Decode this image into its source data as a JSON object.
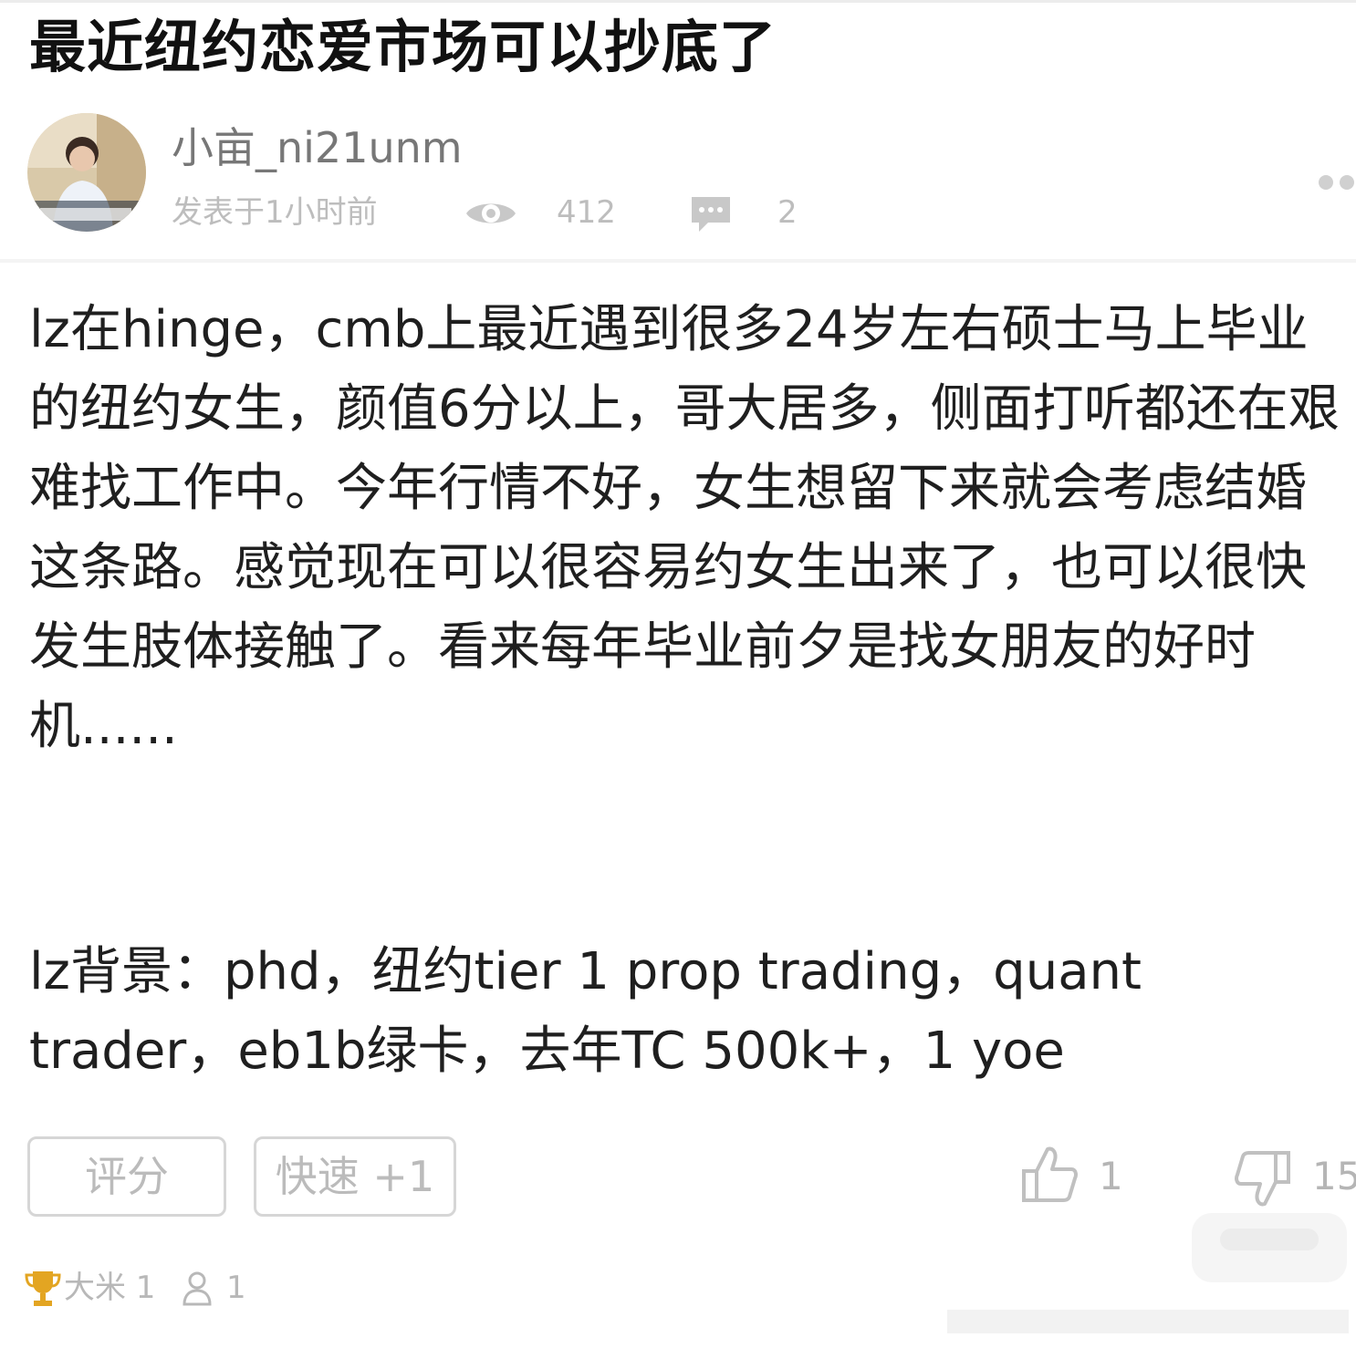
{
  "post": {
    "title": "最近纽约恋爱市场可以抄底了",
    "author": {
      "username": "小亩_ni21unm",
      "avatar_icon": "user-photo-avatar"
    },
    "meta": {
      "posted": "发表于1小时前",
      "views": "412",
      "comments": "2",
      "view_icon": "eye-icon",
      "comment_icon": "comment-bubble-icon"
    },
    "body": "lz在hinge，cmb上最近遇到很多24岁左右硕士马上毕业的纽约女生，颜值6分以上，哥大居多，侧面打听都还在艰难找工作中。今年行情不好，女生想留下来就会考虑结婚这条路。感觉现在可以很容易约女生出来了，也可以很快发生肢体接触了。看来每年毕业前夕是找女朋友的好时机......",
    "background": "lz背景：phd，纽约tier 1 prop trading，quant trader，eb1b绿卡，去年TC 500k+，1 yoe"
  },
  "actions": {
    "rate_label": "评分",
    "fast_label": "快速 +1",
    "likes": "1",
    "dislikes": "15"
  },
  "footer": {
    "rice": "大米 1",
    "followers": "1"
  },
  "colors": {
    "text": "#1f1f1f",
    "muted": "#bdbdbd",
    "border": "#d6d6d6"
  }
}
